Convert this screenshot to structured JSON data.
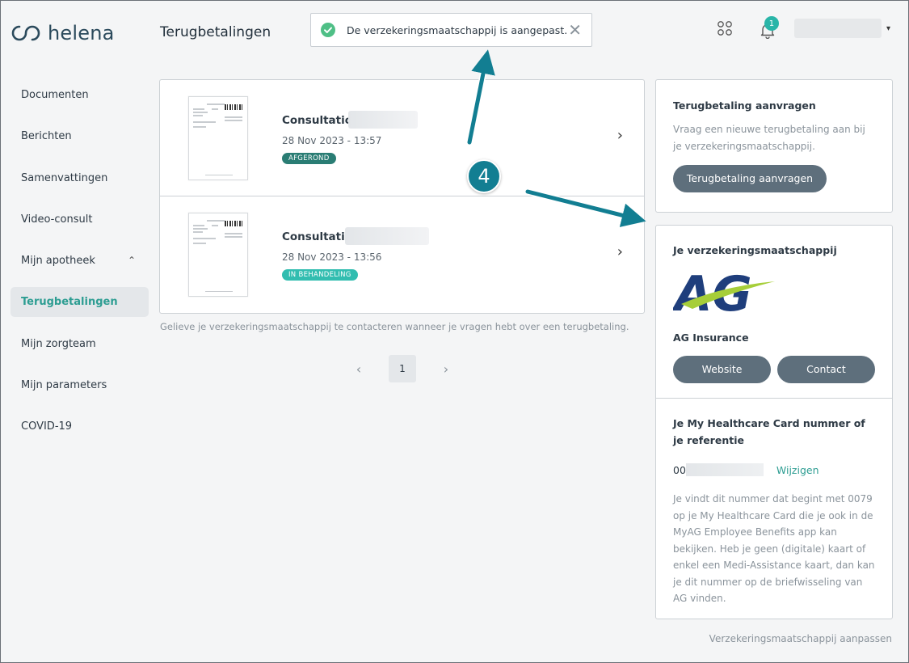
{
  "app": {
    "logo_text": "helena",
    "page_title": "Terugbetalingen"
  },
  "toast": {
    "message": "De verzekeringsmaatschappij is aangepast.",
    "close_icon": "✕"
  },
  "header": {
    "notifications_count": "1",
    "caret": "▾"
  },
  "sidebar": {
    "items": [
      {
        "label": "Documenten"
      },
      {
        "label": "Berichten"
      },
      {
        "label": "Samenvattingen"
      },
      {
        "label": "Video-consult"
      },
      {
        "label": "Mijn apotheek",
        "expand_icon": "⌃"
      },
      {
        "label": "Terugbetalingen",
        "active": true
      },
      {
        "label": "Mijn zorgteam"
      },
      {
        "label": "Mijn parameters"
      },
      {
        "label": "COVID-19"
      }
    ]
  },
  "reimbursements": [
    {
      "title": "Consultation",
      "date": "28 Nov 2023 - 13:57",
      "status": "AFGEROND"
    },
    {
      "title": "Consultation",
      "date": "28 Nov 2023 - 13:56",
      "status": "IN BEHANDELING"
    }
  ],
  "note": "Gelieve je verzekeringsmaatschappij te contacteren wanneer je vragen hebt over een terugbetaling.",
  "pagination": {
    "prev": "‹",
    "current": "1",
    "next": "›"
  },
  "request_card": {
    "heading": "Terugbetaling aanvragen",
    "text": "Vraag een nieuwe terugbetaling aan bij je verzekeringsmaatschappij.",
    "button": "Terugbetaling aanvragen"
  },
  "insurer_card": {
    "heading": "Je verzekeringsmaatschappij",
    "logo_text": "AG",
    "name": "AG Insurance",
    "website_button": "Website",
    "contact_button": "Contact",
    "card_heading": "Je My Healthcare Card nummer of je referentie",
    "number_prefix": "00",
    "change_link": "Wijzigen",
    "explanation": "Je vindt dit nummer dat begint met 0079 op je My Healthcare Card die je ook in de MyAG Employee Benefits app kan bekijken. Heb je geen (digitale) kaart of enkel een Medi-Assistance kaart, dan kan je dit nummer op de briefwisseling van AG vinden."
  },
  "bottom_link": "Verzekeringsmaatschappij aanpassen",
  "annotation": {
    "step": "4"
  },
  "colors": {
    "accent": "#2d9d92",
    "button": "#5e6f7c",
    "annotation": "#127e92",
    "status_done": "#2a7d74",
    "status_busy": "#31bdb0"
  }
}
